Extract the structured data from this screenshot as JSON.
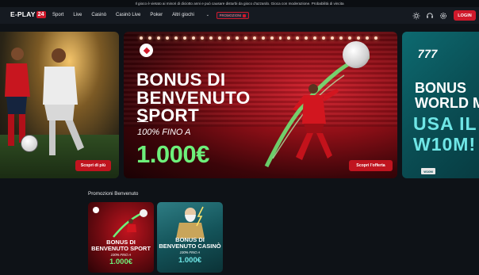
{
  "notice": "Il gioco è vietato ai minori di diciotto anni e può causare disturbi da gioco d'azzardo. Gioca con moderazione. Probabilità di vincita",
  "header": {
    "logo_text": "E-PLAY",
    "logo_badge": "24",
    "nav": [
      "Sport",
      "Live",
      "Casinò",
      "Casinò Live",
      "Poker",
      "Altri giochi"
    ],
    "promo_badge": "PROMOZIONI",
    "login_label": "LOGIN",
    "icons": [
      "sun-icon",
      "headset-icon",
      "gear-icon",
      "user-icon"
    ]
  },
  "banners": [
    {
      "cta": "Scopri di più"
    },
    {
      "title_lines": [
        "BONUS DI",
        "BENVENUTO",
        "SPORT"
      ],
      "subtitle": "100% FINO A",
      "amount": "1.000€",
      "cta": "Scopri l'offerta"
    },
    {
      "title_lines": [
        "BONUS",
        "WORLD M"
      ],
      "sub_lines": [
        "USA IL C",
        "W10M!"
      ],
      "tag": "W10M"
    }
  ],
  "promotions": {
    "title": "Promozioni Benvenuto",
    "cards": [
      {
        "title_lines": [
          "BONUS DI",
          "BENVENUTO SPORT"
        ],
        "subtitle": "100% FINO A",
        "amount": "1.000€"
      },
      {
        "title_lines": [
          "BONUS DI",
          "BENVENUTO CASINÒ"
        ],
        "subtitle": "100% FINO A",
        "amount": "1.000€"
      }
    ]
  },
  "colors": {
    "brand_red": "#d0192b",
    "accent_green": "#6df07a",
    "accent_teal": "#6fe6e6",
    "background": "#0e1217"
  }
}
